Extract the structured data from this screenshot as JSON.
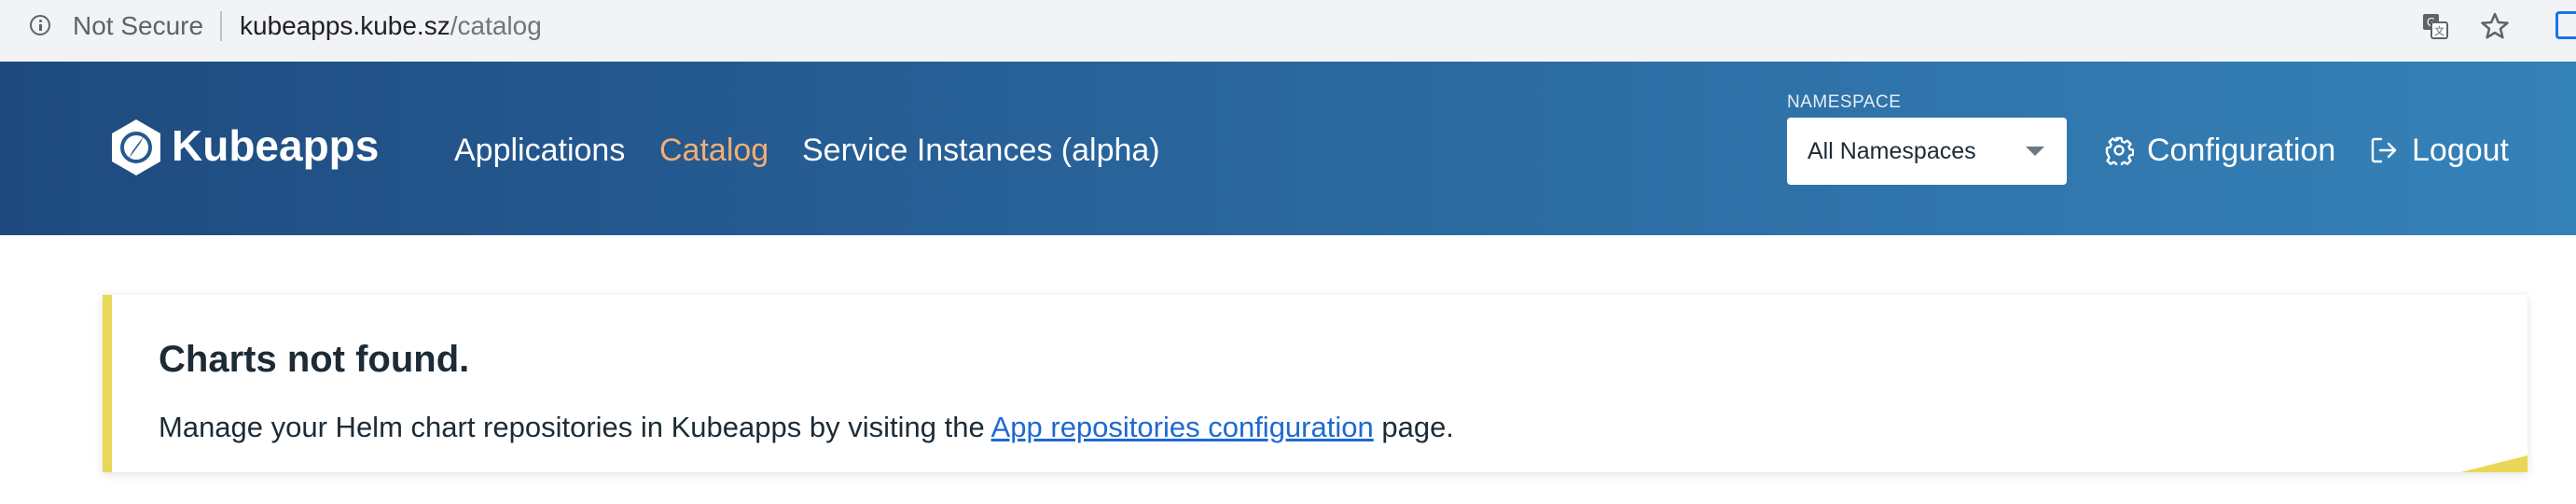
{
  "browser": {
    "security_label": "Not Secure",
    "url_host": "kubeapps.kube.sz",
    "url_path": "/catalog",
    "icons": [
      "info-icon",
      "translate-icon",
      "star-icon",
      "extension-icon"
    ]
  },
  "header": {
    "brand": "Kubeapps",
    "nav": {
      "applications": "Applications",
      "catalog": "Catalog",
      "service_instances": "Service Instances (alpha)"
    },
    "namespace": {
      "label": "NAMESPACE",
      "selected": "All Namespaces"
    },
    "configuration": "Configuration",
    "logout": "Logout",
    "colors": {
      "gradient_start": "#1e4a7f",
      "gradient_end": "#3582b8",
      "active_nav": "#f6ad72"
    }
  },
  "notice": {
    "title": "Charts not found.",
    "text_before": "Manage your Helm chart repositories in Kubeapps by visiting the ",
    "link_text": "App repositories configuration",
    "text_after": " page.",
    "accent_color": "#e9d757",
    "link_color": "#1d69d3"
  }
}
